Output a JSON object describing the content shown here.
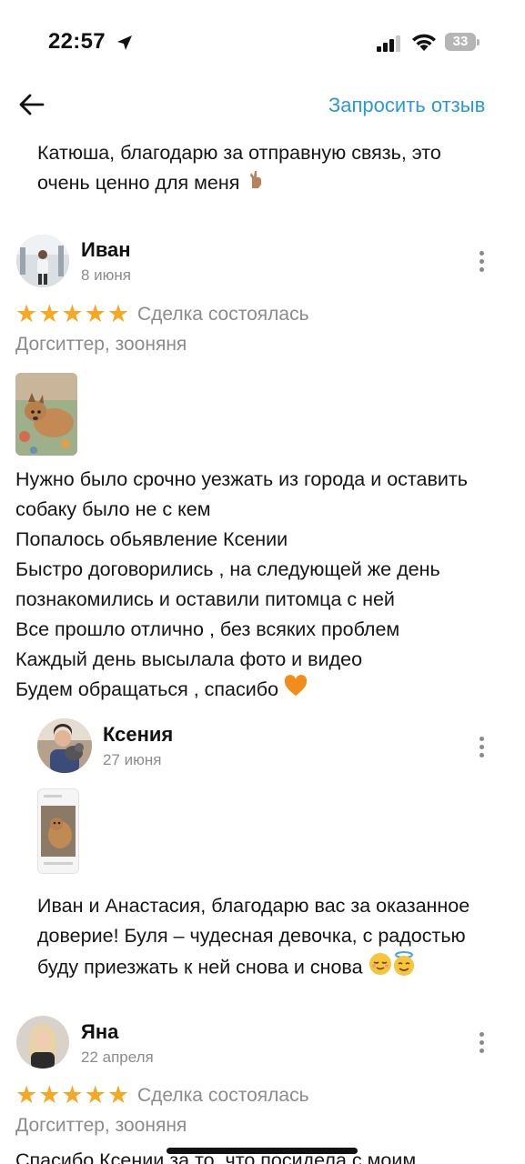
{
  "status_bar": {
    "time": "22:57",
    "battery": "33"
  },
  "header": {
    "request_review": "Запросить отзыв"
  },
  "prev_reply": {
    "lines": [
      "Катюша, благодарю за отправную связь, это",
      "очень ценно для меня"
    ]
  },
  "reviews": [
    {
      "author": "Иван",
      "date": "8 июня",
      "rating": 5,
      "deal": "Сделка состоялась",
      "service": "Догситтер, зооняня",
      "text_lines": [
        "Нужно было срочно уезжать из города и оставить",
        "собаку было не с кем",
        "Попалось обьявление Ксении",
        "Быстро договорились , на следующей же день",
        "познакомились и оставили питомца с ней",
        "Все прошло отлично , без всяких проблем",
        "Каждый день высылала фото и видео",
        "Будем обращаться , спасибо"
      ],
      "reply": {
        "author": "Ксения",
        "date": "27 июня",
        "text_lines": [
          "Иван и Анастасия, благодарю вас за оказанное",
          "доверие! Буля – чудесная девочка, с радостью",
          "буду приезжать к ней снова и снова"
        ]
      }
    },
    {
      "author": "Яна",
      "date": "22 апреля",
      "rating": 5,
      "deal": "Сделка состоялась",
      "service": "Догситтер, зооняня",
      "text_lines": [
        "Спасибо Ксении за то, что посидела с моим"
      ]
    }
  ],
  "stars_text": "★★★★★",
  "colors": {
    "accent": "#2a9ad6",
    "star": "#f7a823",
    "muted": "#8c8c8c"
  }
}
